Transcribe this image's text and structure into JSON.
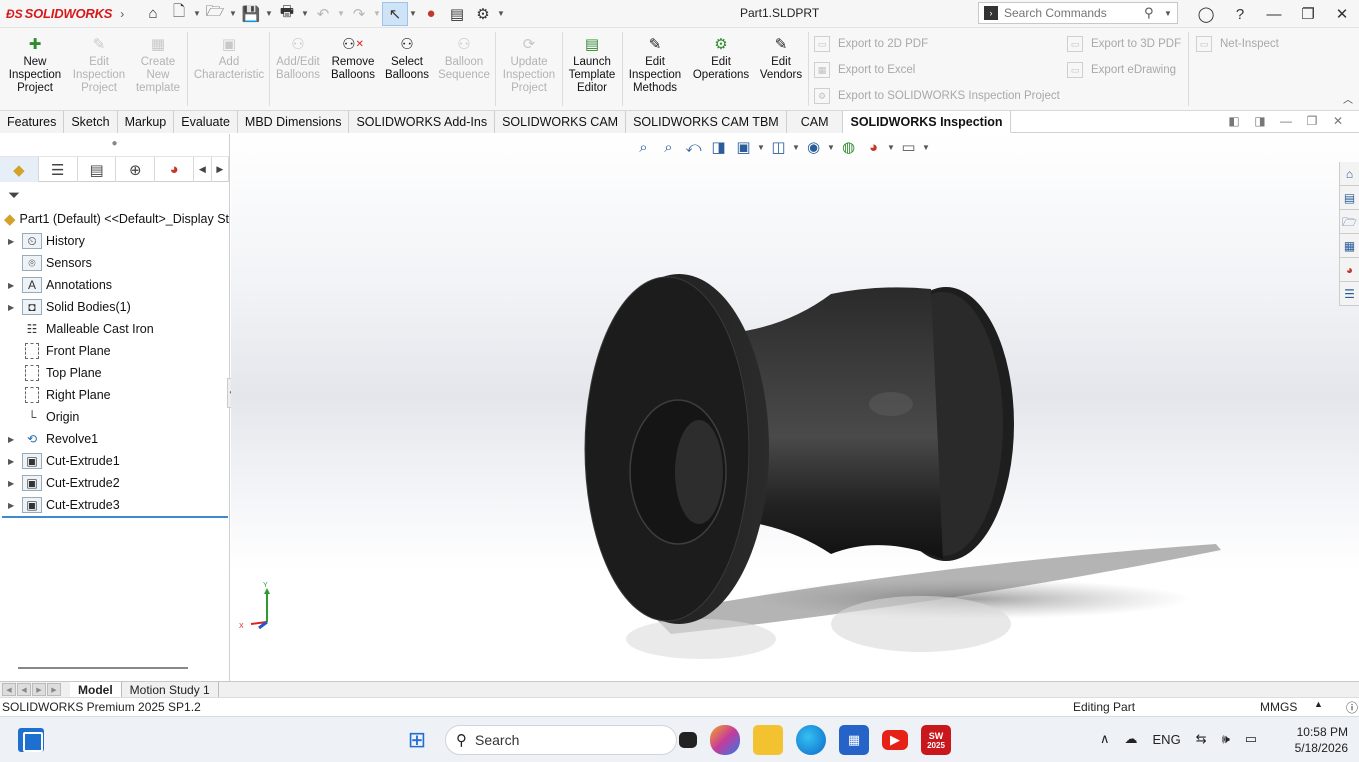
{
  "titlebar": {
    "app_name": "SOLIDWORKS",
    "doc_title": "Part1.SLDPRT",
    "search_placeholder": "Search Commands"
  },
  "commands": {
    "new_inspection_project": "New\nInspection\nProject",
    "edit_inspection_project": "Edit\nInspection\nProject",
    "create_new_template": "Create\nNew\ntemplate",
    "add_characteristic": "Add\nCharacteristic",
    "add_edit_balloons": "Add/Edit\nBalloons",
    "remove_balloons": "Remove\nBalloons",
    "select_balloons": "Select\nBalloons",
    "balloon_sequence": "Balloon\nSequence",
    "update_inspection_project": "Update\nInspection\nProject",
    "launch_template_editor": "Launch\nTemplate\nEditor",
    "edit_inspection_methods": "Edit\nInspection\nMethods",
    "edit_operations": "Edit\nOperations",
    "edit_vendors": "Edit\nVendors",
    "export_2d_pdf": "Export to 2D PDF",
    "export_excel": "Export to Excel",
    "export_inspection_project": "Export to SOLIDWORKS Inspection Project",
    "export_3d_pdf": "Export to 3D PDF",
    "export_edrawing": "Export eDrawing",
    "net_inspect": "Net-Inspect"
  },
  "tabs": [
    "Features",
    "Sketch",
    "Markup",
    "Evaluate",
    "MBD Dimensions",
    "SOLIDWORKS Add-Ins",
    "SOLIDWORKS CAM",
    "SOLIDWORKS CAM TBM",
    "CAM",
    "SOLIDWORKS Inspection"
  ],
  "tree": {
    "root": "Part1 (Default) <<Default>_Display Sta",
    "items": [
      "History",
      "Sensors",
      "Annotations",
      "Solid Bodies(1)",
      "Malleable Cast Iron",
      "Front Plane",
      "Top Plane",
      "Right Plane",
      "Origin",
      "Revolve1",
      "Cut-Extrude1",
      "Cut-Extrude2",
      "Cut-Extrude3"
    ]
  },
  "triad": {
    "y_label": "Y",
    "x_label": "X"
  },
  "bottom_tabs": [
    "Model",
    "Motion Study 1"
  ],
  "status": {
    "product": "SOLIDWORKS Premium 2025 SP1.2",
    "mode": "Editing Part",
    "units": "MMGS"
  },
  "taskbar": {
    "search_label": "Search",
    "language": "ENG",
    "time": "10:58 PM",
    "date": "5/18/2026",
    "sw_badge": "2025"
  },
  "colors": {
    "brand_red": "#d6191b",
    "selection_blue": "#3c8bd1",
    "part_body": "#1c1c1c"
  }
}
